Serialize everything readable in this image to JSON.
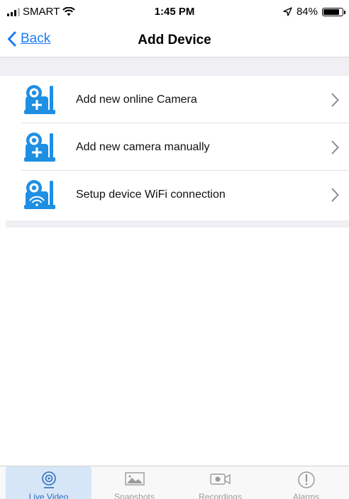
{
  "status_bar": {
    "carrier": "SMART",
    "time": "1:45 PM",
    "battery_percent": "84%",
    "battery_level": 0.84
  },
  "nav": {
    "back_label": "Back",
    "title": "Add Device"
  },
  "items": [
    {
      "label": "Add new online Camera",
      "icon": "camera-add-icon"
    },
    {
      "label": "Add new camera manually",
      "icon": "camera-add-icon"
    },
    {
      "label": "Setup device WiFi connection",
      "icon": "camera-wifi-icon"
    }
  ],
  "tabs": [
    {
      "label": "Live Video",
      "icon": "live-video-icon",
      "active": true
    },
    {
      "label": "Snapshots",
      "icon": "snapshot-icon",
      "active": false
    },
    {
      "label": "Recordings",
      "icon": "recording-icon",
      "active": false
    },
    {
      "label": "Alarms",
      "icon": "alarm-icon",
      "active": false
    }
  ],
  "colors": {
    "accent": "#1a7cf5",
    "icon_blue": "#1e8fe3",
    "active_tab_bg": "#d6e6f7",
    "separator_bg": "#efeff4"
  }
}
